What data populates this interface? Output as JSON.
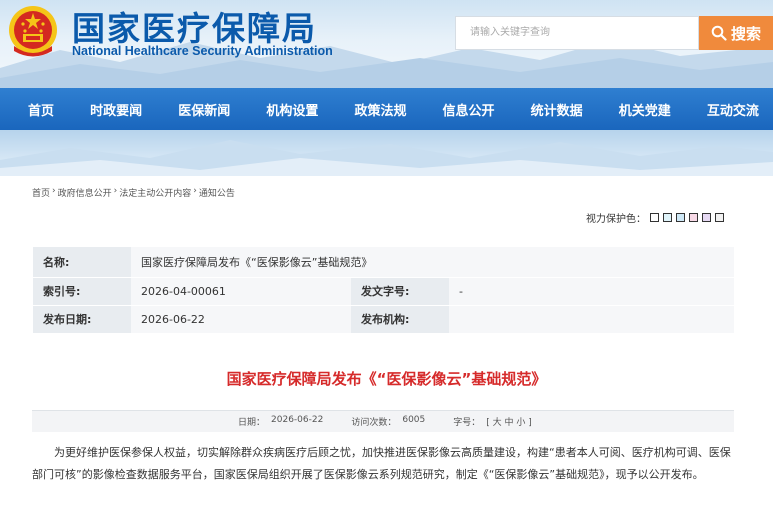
{
  "header": {
    "site_title": "国家医疗保障局",
    "site_subtitle": "National Healthcare Security Administration",
    "search_placeholder": "请输入关键字查询",
    "search_button": "搜索",
    "emblem_icon": "national-emblem-icon"
  },
  "nav": {
    "items": [
      "首页",
      "时政要闻",
      "医保新闻",
      "机构设置",
      "政策法规",
      "信息公开",
      "统计数据",
      "机关党建",
      "互动交流"
    ]
  },
  "breadcrumb": {
    "items": [
      "首页",
      "政府信息公开",
      "法定主动公开内容",
      "通知公告"
    ],
    "separator": "›"
  },
  "eye_protection": {
    "label": "视力保护色：",
    "colors": [
      "#ffffff",
      "#e0f4fa",
      "#cfe9f7",
      "#f7d9e6",
      "#e6d9f3",
      "#f2f2f2"
    ]
  },
  "info_table": {
    "name_label": "名称:",
    "name_value": "国家医疗保障局发布《“医保影像云”基础规范》",
    "index_label": "索引号:",
    "index_value": "2026-04-00061",
    "doc_no_label": "发文字号:",
    "doc_no_value": "-",
    "date_label": "发布日期:",
    "date_value": "2026-06-22",
    "org_label": "发布机构:",
    "org_value": ""
  },
  "article": {
    "title": "国家医疗保障局发布《“医保影像云”基础规范》",
    "meta_date_label": "日期：",
    "meta_date": "2026-06-22",
    "meta_visits_label": "访问次数：",
    "meta_visits": "6005",
    "meta_font_label": "字号：",
    "meta_font_options": "[ 大 中 小 ]",
    "body": "为更好维护医保参保人权益，切实解除群众疾病医疗后顾之忧，加快推进医保影像云高质量建设，构建“患者本人可阅、医疗机构可调、医保部门可核”的影像检查数据服务平台，国家医保局组织开展了医保影像云系列规范研究，制定《“医保影像云”基础规范》，现予以公开发布。"
  },
  "colors": {
    "brand_blue": "#0b5aab",
    "nav_blue": "#1a66bd",
    "search_orange": "#f08a3c",
    "title_red": "#d62b2b"
  }
}
